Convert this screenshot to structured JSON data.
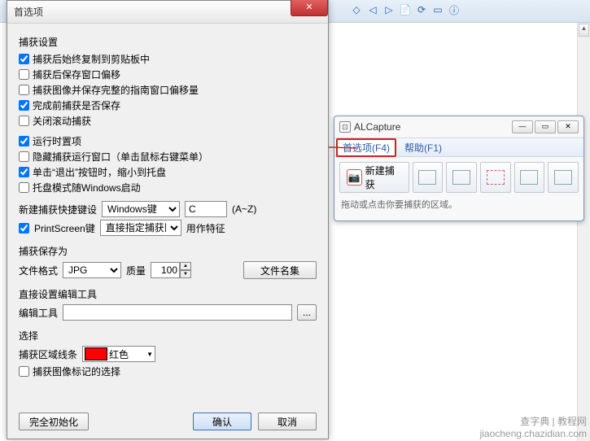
{
  "dialog": {
    "title": "首选项",
    "sections": {
      "capture_settings": {
        "label": "捕获设置",
        "items": [
          {
            "label": "捕获后始终复制到剪贴板中",
            "checked": true
          },
          {
            "label": "捕获后保存窗口偏移",
            "checked": false
          },
          {
            "label": "捕获图像并保存完整的指南窗口偏移量",
            "checked": false
          },
          {
            "label": "完成前捕获是否保存",
            "checked": true
          },
          {
            "label": "关闭滚动捕获",
            "checked": false
          }
        ]
      },
      "runtime_options": {
        "label": "运行时置项",
        "items": [
          {
            "label": "隐藏捕获运行窗口（单击鼠标右键菜单）",
            "checked": false
          },
          {
            "label": "单击“退出”按钮时，缩小到托盘",
            "checked": true
          },
          {
            "label": "托盘模式随Windows启动",
            "checked": false
          }
        ]
      },
      "hotkey": {
        "label": "新建捕获快捷键设",
        "key_mod": "Windows键",
        "key_char": "C",
        "range": "(A~Z)"
      },
      "printscreen": {
        "checked": true,
        "label": "PrintScreen键",
        "mode": "直接指定捕获区",
        "suffix": "用作特征"
      },
      "save_as": {
        "label": "捕获保存为",
        "format_label": "文件格式",
        "format_value": "JPG",
        "quality_label": "质量",
        "quality_value": "100",
        "filename_btn": "文件名集"
      },
      "editor": {
        "label": "直接设置编辑工具",
        "row_label": "编辑工具",
        "path": "",
        "browse": "..."
      },
      "selection": {
        "label": "选择",
        "line_label": "捕获区域线条",
        "color_name": "红色",
        "color_hex": "#ff0000",
        "chk_label": "捕获图像标记的选择",
        "chk_checked": false
      }
    },
    "buttons": {
      "reset": "完全初始化",
      "ok": "确认",
      "cancel": "取消"
    }
  },
  "appwin": {
    "title": "ALCapture",
    "tabs": [
      {
        "label": "首选项(F4)",
        "active": true
      },
      {
        "label": "帮助(F1)",
        "active": false
      }
    ],
    "new_capture": "新建捕获",
    "hint": "拖动或点击你要捕获的区域。"
  },
  "watermark": {
    "line1": "查字典 | 教程网",
    "line2": "jiaocheng.chazidian.com"
  }
}
